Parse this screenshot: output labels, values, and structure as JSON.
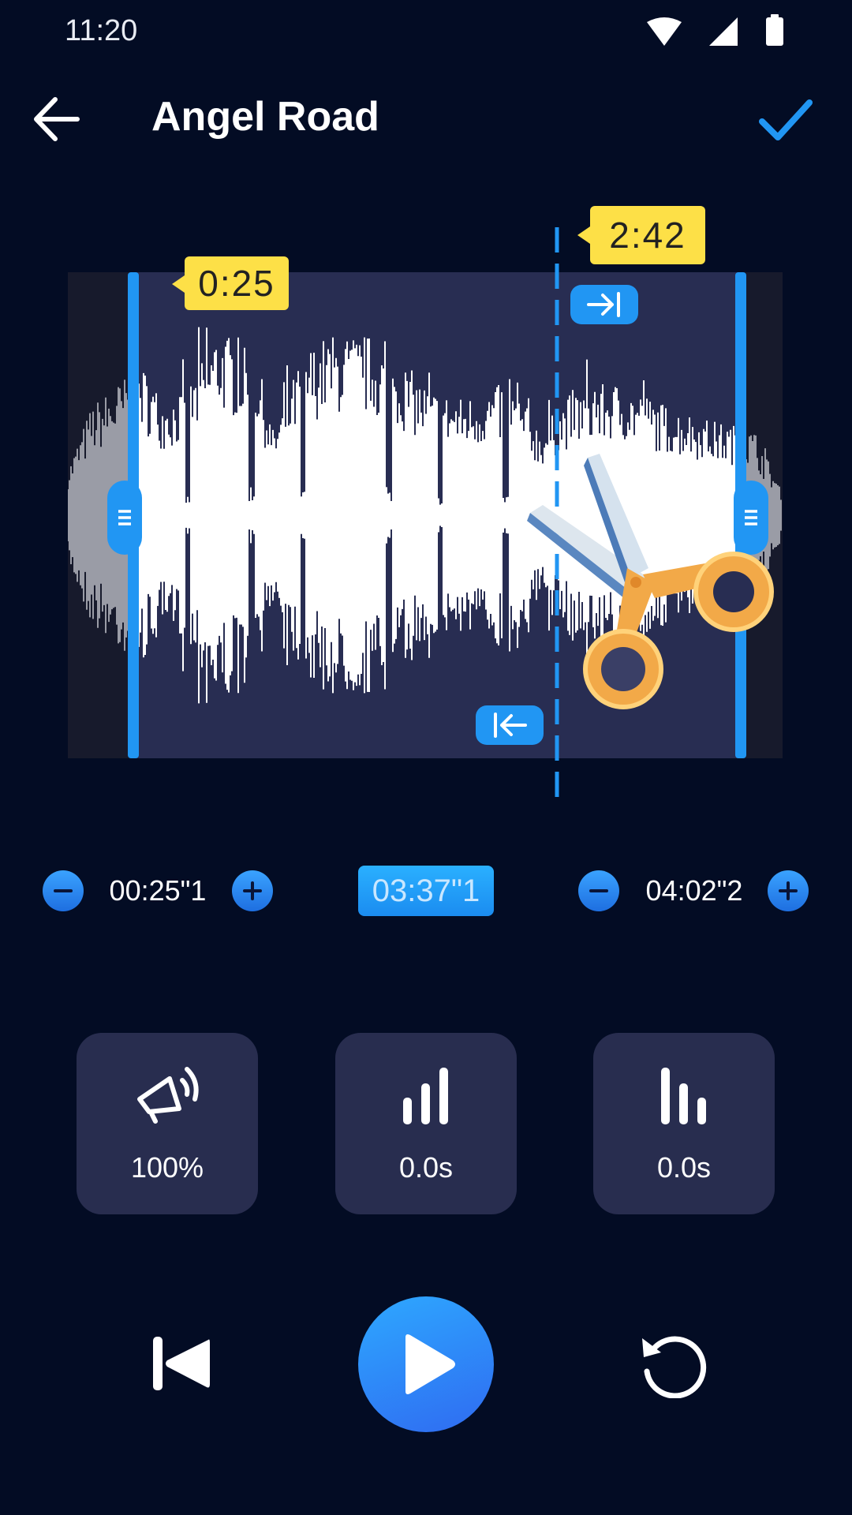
{
  "status_bar": {
    "time": "11:20",
    "icons": [
      "wifi-icon",
      "cell-signal-icon",
      "battery-icon"
    ]
  },
  "header": {
    "title": "Angel Road",
    "back_icon": "back-arrow-icon",
    "confirm_icon": "check-icon"
  },
  "editor": {
    "start_marker": "0:25",
    "playhead_marker": "2:42",
    "jump_end_icon": "jump-to-end-icon",
    "jump_start_icon": "jump-to-start-icon",
    "cut_icon": "scissors-icon"
  },
  "time_controls": {
    "start_value": "00:25\"1",
    "duration_value": "03:37\"1",
    "end_value": "04:02\"2"
  },
  "effects": [
    {
      "icon": "volume-icon",
      "label": "100%"
    },
    {
      "icon": "fade-in-icon",
      "label": "0.0s"
    },
    {
      "icon": "fade-out-icon",
      "label": "0.0s"
    }
  ],
  "playback": {
    "prev_icon": "skip-previous-icon",
    "play_icon": "play-icon",
    "reset_icon": "reset-icon"
  },
  "colors": {
    "background": "#030c24",
    "accent": "#2196f3",
    "marker": "#fde047",
    "card": "#282d4f"
  }
}
